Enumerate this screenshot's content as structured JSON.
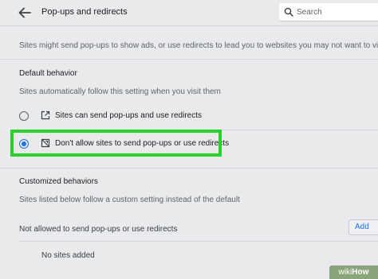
{
  "header": {
    "title": "Pop-ups and redirects",
    "search_placeholder": "Search"
  },
  "description": "Sites might send pop-ups to show ads, or use redirects to lead you to websites you may not want to visit",
  "default_behavior": {
    "title": "Default behavior",
    "subtitle": "Sites automatically follow this setting when you visit them",
    "options": [
      {
        "label": "Sites can send pop-ups and use redirects",
        "icon": "open-in-new-icon",
        "selected": false
      },
      {
        "label": "Don't allow sites to send pop-ups or use redirects",
        "icon": "popup-blocked-icon",
        "selected": true
      }
    ]
  },
  "customized_behaviors": {
    "title": "Customized behaviors",
    "subtitle": "Sites listed below follow a custom setting instead of the default",
    "not_allowed_label": "Not allowed to send pop-ups or use redirects",
    "add_label": "Add",
    "empty_text": "No sites added"
  },
  "watermark": {
    "prefix": "wiki",
    "suffix": "How"
  },
  "colors": {
    "accent": "#1a73e8",
    "highlight": "#2bd12b",
    "background": "#e9eaec"
  }
}
